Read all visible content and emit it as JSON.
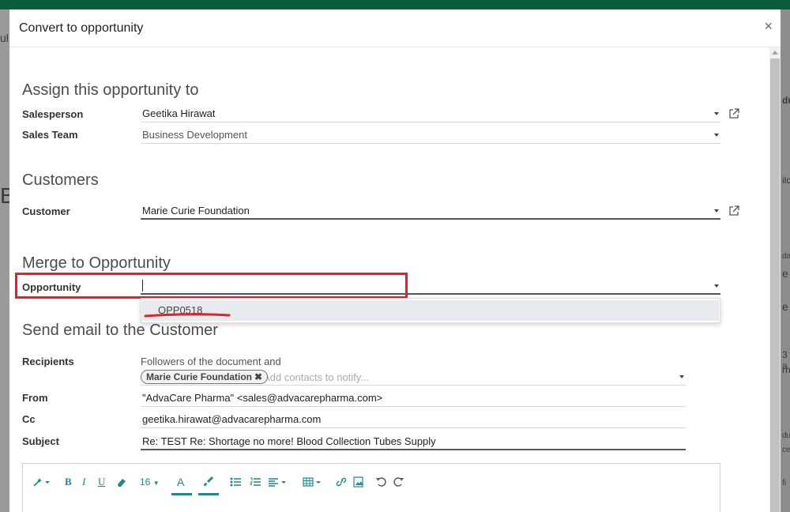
{
  "modal": {
    "title": "Convert to opportunity",
    "close_symbol": "×"
  },
  "sections": {
    "assign": "Assign this opportunity to",
    "customers": "Customers",
    "merge": "Merge to Opportunity",
    "email": "Send email to the Customer"
  },
  "fields": {
    "salesperson": {
      "label": "Salesperson",
      "value": "Geetika Hirawat"
    },
    "sales_team": {
      "label": "Sales Team",
      "value": "Business Development"
    },
    "customer": {
      "label": "Customer",
      "value": "Marie Curie Foundation"
    },
    "opportunity": {
      "label": "Opportunity",
      "value": ""
    },
    "recipients": {
      "label": "Recipients",
      "note": "Followers of the document and",
      "tag": "Marie Curie Foundation",
      "placeholder": "Add contacts to notify..."
    },
    "from": {
      "label": "From",
      "value": "\"AdvaCare Pharma\" <sales@advacarepharma.com>"
    },
    "cc": {
      "label": "Cc",
      "value": "geetika.hirawat@advacarepharma.com"
    },
    "subject": {
      "label": "Subject",
      "value": "Re: TEST Re: Shortage no more! Blood Collection Tubes Supply"
    }
  },
  "dropdown": {
    "items": [
      "OPP0518"
    ]
  },
  "editor": {
    "font_size": "16",
    "bold": "B",
    "italic": "I",
    "underline": "U",
    "font_color": "A"
  },
  "colors": {
    "accent": "#1a8a8a",
    "highlight": "#e2212b",
    "topbar": "#0a5c3b"
  },
  "background": {
    "frag_a": "ul",
    "frag_b": "B",
    "frag_c": "du",
    "frag_d": "ild",
    "frag_e": "da",
    "frag_f": "e",
    "frag_g": "e",
    "frag_h": "3 a",
    "frag_i": "rn",
    "frag_j": "du",
    "frag_k": "ce",
    "frag_l": "fi"
  }
}
